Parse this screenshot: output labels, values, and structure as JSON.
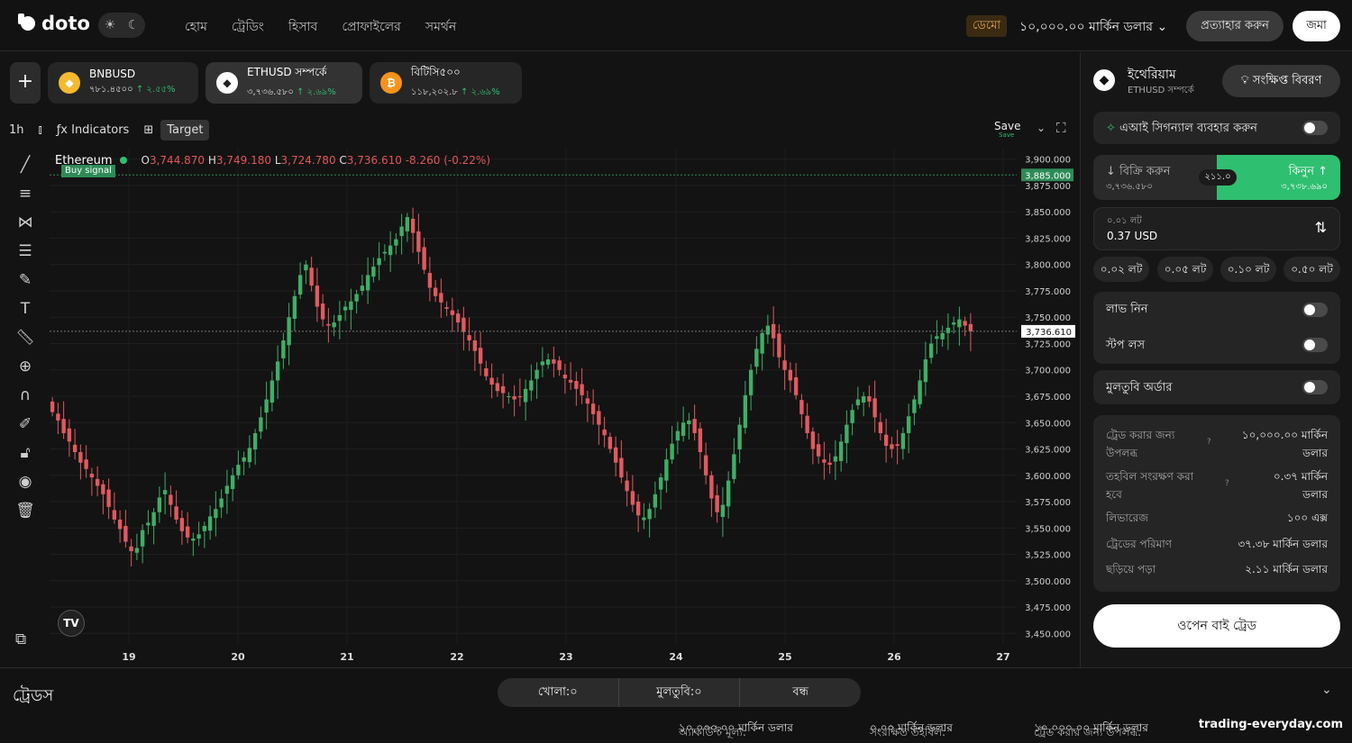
{
  "header": {
    "logo": "doto",
    "theme_icons": [
      "☀",
      "☾"
    ],
    "nav": [
      "হোম",
      "ট্রেডিং",
      "হিসাব",
      "প্রোফাইলের",
      "সমর্থন"
    ],
    "demo": "ডেমো",
    "balance": "১০,০০০.০০ মার্কিন ডলার ⌄",
    "withdraw": "প্রত্যাহার করুন",
    "deposit": "জমা"
  },
  "tickers": [
    {
      "name": "BNBUSD",
      "price": "৭৮১.৪৫০০",
      "change": "↑ ২.৫৫%",
      "icon": "bnb-icon",
      "color": "#f3ba2f"
    },
    {
      "name": "ETHUSD সম্পর্কে",
      "price": "৩,৭৩৬.৫৮০",
      "change": "↑ ২.৬৯%",
      "icon": "eth-icon",
      "color": "#ffffff"
    },
    {
      "name": "বিটিসি৫০০",
      "price": "১১৮,২০২.৮",
      "change": "↑ ২.৬৯%",
      "icon": "btc-icon",
      "color": "#f7931a"
    }
  ],
  "toolbar": {
    "interval": "1h",
    "indicators": "Indicators",
    "target": "Target",
    "save": "Save",
    "save_sub": "Save"
  },
  "legend": {
    "symbol": "Ethereum",
    "o_label": "O",
    "o": "3,744.870",
    "h_label": "H",
    "h": "3,749.180",
    "l_label": "L",
    "l": "3,724.780",
    "c_label": "C",
    "c": "3,736.610",
    "change": "-8.260 (-0.22%)",
    "signal": "Buy signal"
  },
  "chart_data": {
    "type": "candlestick",
    "x_ticks": [
      "19",
      "20",
      "21",
      "22",
      "23",
      "24",
      "25",
      "26",
      "27"
    ],
    "y_ticks": [
      "3,900.000",
      "3,875.000",
      "3,850.000",
      "3,825.000",
      "3,800.000",
      "3,775.000",
      "3,750.000",
      "3,725.000",
      "3,700.000",
      "3,675.000",
      "3,650.000",
      "3,625.000",
      "3,600.000",
      "3,575.000",
      "3,550.000",
      "3,525.000",
      "3,500.000",
      "3,475.000",
      "3,450.000"
    ],
    "ylim": [
      3440,
      3910
    ],
    "last_price": 3736.61,
    "last_price_label": "3,736.610",
    "signal_price": 3885,
    "signal_price_label": "3,885.000",
    "close_series": [
      3660,
      3652,
      3640,
      3632,
      3622,
      3612,
      3606,
      3598,
      3590,
      3582,
      3570,
      3558,
      3549,
      3537,
      3528,
      3531,
      3548,
      3555,
      3565,
      3579,
      3586,
      3572,
      3558,
      3547,
      3541,
      3540,
      3544,
      3552,
      3561,
      3568,
      3578,
      3590,
      3600,
      3610,
      3617,
      3626,
      3640,
      3655,
      3672,
      3690,
      3708,
      3728,
      3750,
      3770,
      3790,
      3800,
      3780,
      3760,
      3748,
      3742,
      3745,
      3752,
      3760,
      3765,
      3772,
      3780,
      3790,
      3798,
      3806,
      3812,
      3818,
      3824,
      3836,
      3845,
      3830,
      3812,
      3795,
      3778,
      3770,
      3764,
      3758,
      3752,
      3745,
      3736,
      3728,
      3718,
      3706,
      3694,
      3686,
      3680,
      3678,
      3675,
      3672,
      3674,
      3682,
      3690,
      3700,
      3708,
      3710,
      3706,
      3700,
      3692,
      3688,
      3682,
      3676,
      3668,
      3658,
      3648,
      3638,
      3625,
      3612,
      3598,
      3585,
      3572,
      3562,
      3560,
      3568,
      3582,
      3598,
      3615,
      3630,
      3642,
      3650,
      3652,
      3640,
      3622,
      3600,
      3578,
      3565,
      3572,
      3595,
      3620,
      3648,
      3676,
      3700,
      3720,
      3735,
      3742,
      3730,
      3712,
      3700,
      3690,
      3676,
      3658,
      3640,
      3625,
      3618,
      3612,
      3610,
      3618,
      3632,
      3648,
      3662,
      3672,
      3675,
      3670,
      3655,
      3640,
      3628,
      3625,
      3628,
      3640,
      3656,
      3672,
      3690,
      3710,
      3725,
      3732,
      3735,
      3740,
      3745,
      3748,
      3742,
      3736.61
    ]
  },
  "panel": {
    "title": "ইথেরিয়াম",
    "subtitle": "ETHUSD সম্পর্কে",
    "summary_btn": "সংক্ষিপ্ত বিবরণ",
    "ai_signal": "এআই সিগন্যাল ব্যবহার করুন",
    "sell_label": "↓ বিক্রি করুন",
    "sell_price": "৩,৭৩৬.৫৮০",
    "spread": "২১১.০",
    "buy_label": "কিনুন ↑",
    "buy_price": "৩,৭৩৮.৬৯০",
    "lot_label": "০.০১ লট",
    "amount": "0.37 USD",
    "lots": [
      "০.০২ লট",
      "০.০৫ লট",
      "০.১০ লট",
      "০.৫০ লট"
    ],
    "take_profit": "লাভ নিন",
    "stop_loss": "স্টপ লস",
    "pending": "মুলতুবি অর্ডার",
    "info": [
      {
        "k": "ট্রেড করার জন্য উপলব্ধ",
        "v": "১০,০০০.০০ মার্কিন ডলার"
      },
      {
        "k": "তহবিল সংরক্ষণ করা হবে",
        "v": "০.৩৭ মার্কিন ডলার"
      },
      {
        "k": "লিভারেজ",
        "v": "১০০ এক্স"
      },
      {
        "k": "ট্রেডের পরিমাণ",
        "v": "৩৭.৩৮ মার্কিন ডলার"
      },
      {
        "k": "ছড়িয়ে পড়া",
        "v": "২.১১ মার্কিন ডলার"
      }
    ],
    "open_btn": "ওপেন বাই ট্রেড"
  },
  "trades": {
    "title": "ট্রেডস",
    "tabs": [
      "খোলা:০",
      "মুলতুবি:০",
      "বন্ধ"
    ]
  },
  "footer": {
    "account_label": "অ্যাকাউন্ট মূল্য:",
    "account_value": "১০,০০০.০০ মার্কিন ডলার",
    "reserved_label": "সংরক্ষিত তহবিল:",
    "reserved_value": "০.০০ মার্কিন ডলার",
    "available_label": "ট্রেড করার জন্য উপলব্ধ:",
    "available_value": "১০,০০০.০০ মার্কিন ডলার",
    "watermark": "trading-everyday.com"
  }
}
